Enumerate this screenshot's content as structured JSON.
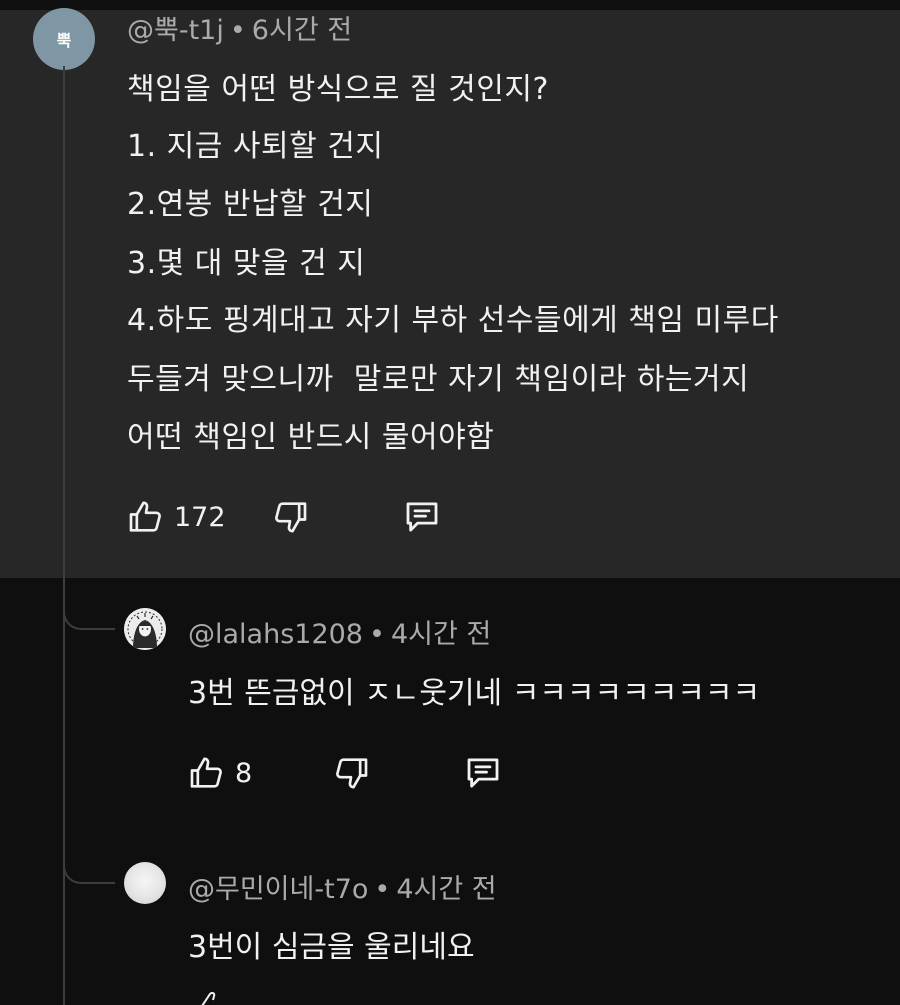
{
  "main_comment": {
    "avatar_text": "뿍",
    "author": "@뿍-t1j",
    "separator": "•",
    "time": "6시간 전",
    "lines": [
      "책임을 어떤 방식으로 질 것인지?",
      "1. 지금 사퇴할 건지",
      "2.연봉 반납할 건지",
      "3.몇 대 맞을 건 지",
      "4.하도 핑계대고 자기 부하 선수들에게 책임 미루다",
      "두들겨 맞으니까  말로만 자기 책임이라 하는거지",
      "어떤 책임인 반드시 물어야함"
    ],
    "likes": "172"
  },
  "replies": [
    {
      "author": "@lalahs1208",
      "separator": "•",
      "time": "4시간 전",
      "text": "3번 뜬금없이 ㅈㄴ웃기네 ㅋㅋㅋㅋㅋㅋㅋㅋㅋ",
      "likes": "8"
    },
    {
      "author": "@무민이네-t7o",
      "separator": "•",
      "time": "4시간 전",
      "text": "3번이 심금을 울리네요"
    }
  ],
  "icons": {
    "like": "thumbs-up-icon",
    "dislike": "thumbs-down-icon",
    "reply": "reply-comment-icon"
  },
  "colors": {
    "background": "#0f0f0f",
    "highlight_comment_bg": "#272727",
    "text": "#f1f1f1",
    "meta_text": "#aaaaaa",
    "avatar_bg": "#7f96a4"
  }
}
